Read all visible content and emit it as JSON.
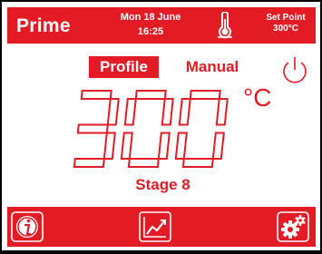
{
  "header": {
    "brand": "Prime",
    "date": "Mon 18 June",
    "time": "16:25",
    "setpoint_label": "Set Point",
    "setpoint_value": "300°C"
  },
  "modes": {
    "profile_label": "Profile",
    "manual_label": "Manual",
    "active": "Profile"
  },
  "readout": {
    "temperature": "300",
    "unit": "°C",
    "stage_label": "Stage 8"
  },
  "icons": {
    "thermometer": "thermometer-icon",
    "power": "power-icon",
    "info": "info-icon",
    "graph": "graph-icon",
    "settings": "settings-icon"
  },
  "colors": {
    "accent": "#e21b24",
    "background": "#ffffff",
    "frame": "#000000"
  }
}
